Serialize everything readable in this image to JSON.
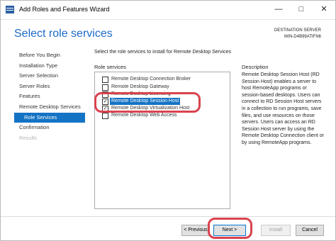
{
  "window": {
    "title": "Add Roles and Features Wizard"
  },
  "page": {
    "heading": "Select role services"
  },
  "destination": {
    "label": "DESTINATION SERVER",
    "server": "WIN-D4B99ATIFN6"
  },
  "nav": {
    "items": [
      {
        "label": "Before You Begin",
        "state": "normal"
      },
      {
        "label": "Installation Type",
        "state": "normal"
      },
      {
        "label": "Server Selection",
        "state": "normal"
      },
      {
        "label": "Server Roles",
        "state": "normal"
      },
      {
        "label": "Features",
        "state": "normal"
      },
      {
        "label": "Remote Desktop Services",
        "state": "normal"
      },
      {
        "label": "Role Services",
        "state": "active"
      },
      {
        "label": "Confirmation",
        "state": "normal"
      },
      {
        "label": "Results",
        "state": "disabled"
      }
    ]
  },
  "main": {
    "instruction": "Select the role services to install for Remote Desktop Services",
    "role_services_label": "Role services",
    "description_label": "Description",
    "role_services": [
      {
        "label": "Remote Desktop Connection Broker",
        "checked": false
      },
      {
        "label": "Remote Desktop Gateway",
        "checked": false
      },
      {
        "label": "Remote Desktop Licensing",
        "checked": false
      },
      {
        "label": "Remote Desktop Session Host",
        "checked": true,
        "selected": true
      },
      {
        "label": "Remote Desktop Virtualization Host",
        "checked": true
      },
      {
        "label": "Remote Desktop Web Access",
        "checked": false
      }
    ],
    "description": "Remote Desktop Session Host (RD Session Host) enables a server to host RemoteApp programs or session-based desktops. Users can connect to RD Session Host servers in a collection to run programs, save files, and use resources on those servers. Users can access an RD Session Host server by using the Remote Desktop Connection client or by using RemoteApp programs."
  },
  "buttons": {
    "previous": "< Previous",
    "next": "Next >",
    "install": "Install",
    "cancel": "Cancel"
  },
  "colors": {
    "accent": "#1473c4",
    "heading": "#1b6ac9",
    "annotation": "#d9434f"
  }
}
